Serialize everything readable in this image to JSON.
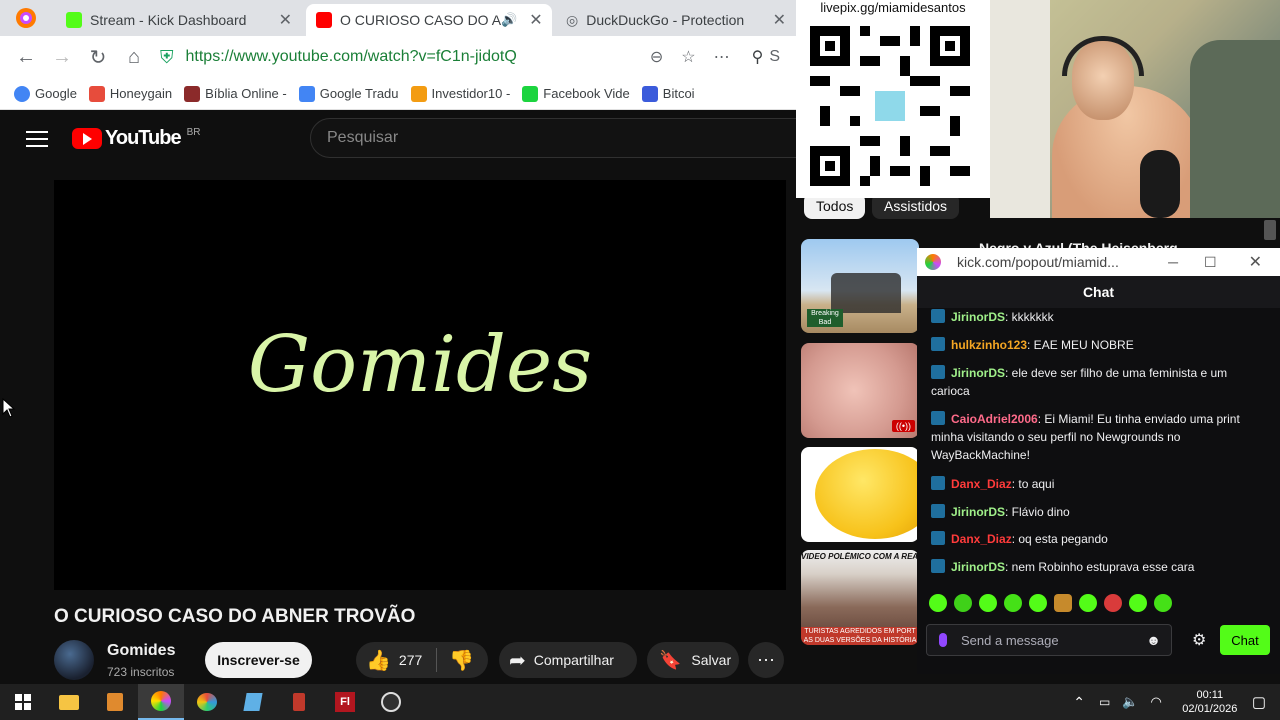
{
  "browser": {
    "tabs": [
      {
        "label": "Stream - Kick Dashboard",
        "favicon_color": "#53fc18"
      },
      {
        "label": "O CURIOSO CASO DO A",
        "favicon_color": "#ff0000"
      },
      {
        "label": "DuckDuckGo - Protection",
        "favicon_color": "#5f6368"
      }
    ],
    "url": "https://www.youtube.com/watch?v=fC1n-jidotQ",
    "search_partial": "S",
    "bookmarks": [
      {
        "label": "Google",
        "color": "#4285f4"
      },
      {
        "label": "Honeygain",
        "color": "#e74c3c"
      },
      {
        "label": "Bíblia Online -",
        "color": "#8b2a2a"
      },
      {
        "label": "Google Tradu",
        "color": "#4285f4"
      },
      {
        "label": "Investidor10 -",
        "color": "#f39c12"
      },
      {
        "label": "Facebook Vide",
        "color": "#1cd43f"
      },
      {
        "label": "Bitcoi",
        "color": "#3b5bdb"
      }
    ]
  },
  "youtube": {
    "logo_text": "YouTube",
    "logo_region": "BR",
    "search_placeholder": "Pesquisar",
    "video_overlay_text": "Gomides",
    "video_title": "O CURIOSO CASO DO ABNER TROVÃO",
    "channel_name": "Gomides",
    "subscribers": "723 inscritos",
    "subscribe_label": "Inscrever-se",
    "likes": "277",
    "share_label": "Compartilhar",
    "save_label": "Salvar",
    "chips": [
      "Todos",
      "Assistidos"
    ],
    "recommended_title_partial": "Negro y Azul (The Heisenberg",
    "thumb_text_1": "Breaking Bad",
    "thumb_text_4_top": "VIDEO POLÊMICO COM A REAL",
    "thumb_text_4_bottom": "TURISTAS AGREDIDOS EM PORT AS DUAS VERSÕES DA HISTÓRIA"
  },
  "overlay": {
    "qr_label": "livepix.gg/miamidesantos"
  },
  "chat_popout": {
    "url": "kick.com/popout/miamid...",
    "header": "Chat",
    "messages": [
      {
        "user": "JirinorDS",
        "color": "#a0f08a",
        "text": ": kkkkkkk"
      },
      {
        "user": "hulkzinho123",
        "color": "#f5a623",
        "text": ": EAE MEU NOBRE"
      },
      {
        "user": "JirinorDS",
        "color": "#a0f08a",
        "text": ": ele deve ser filho de uma feminista e um carioca"
      },
      {
        "user": "CaioAdriel2006",
        "color": "#ff6b8a",
        "text": ": Ei Miami! Eu tinha enviado uma print minha visitando o seu perfil no Newgrounds no WayBackMachine!"
      },
      {
        "user": "Danx_Diaz",
        "color": "#ff3b3b",
        "text": ": to aqui"
      },
      {
        "user": "JirinorDS",
        "color": "#a0f08a",
        "text": ": Flávio dino"
      },
      {
        "user": "Danx_Diaz",
        "color": "#ff3b3b",
        "text": ": oq esta pegando"
      },
      {
        "user": "JirinorDS",
        "color": "#a0f08a",
        "text": ": nem Robinho estuprava esse cara"
      }
    ],
    "input_placeholder": "Send a message",
    "send_label": "Chat"
  },
  "taskbar": {
    "time": "00:11",
    "date": "02/01/2026"
  }
}
